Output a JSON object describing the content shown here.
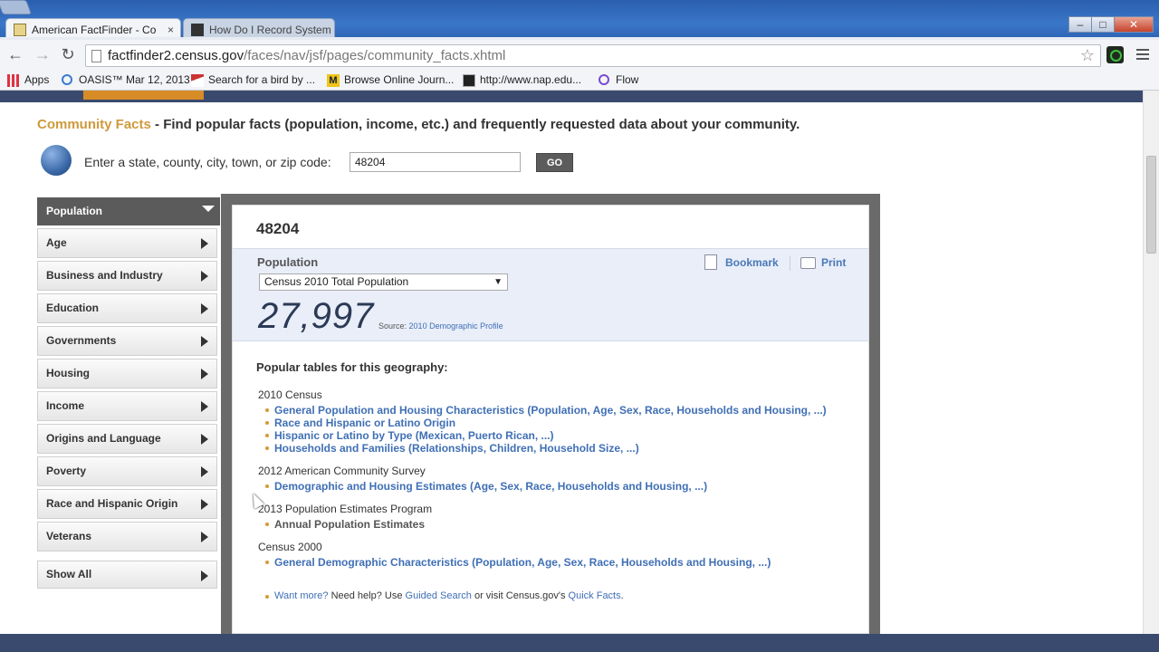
{
  "browser": {
    "tabs": [
      {
        "label": "American FactFinder - Co",
        "active": true
      },
      {
        "label": "How Do I Record System",
        "active": false
      }
    ],
    "tab_close": "×",
    "url_host": "factfinder2.census.gov",
    "url_path": "/faces/nav/jsf/pages/community_facts.xhtml",
    "window_buttons": {
      "minimize": "–",
      "maximize": "□",
      "close": "✕"
    },
    "nav": {
      "back": "←",
      "forward": "→",
      "reload": "↻"
    },
    "star": "☆",
    "bookmarks": [
      "Apps",
      "OASIS™ Mar 12, 2013",
      "Search for a bird by ...",
      "Browse Online Journ...",
      "http://www.nap.edu...",
      "Flow"
    ]
  },
  "page": {
    "heading_accent": "Community Facts",
    "heading_rest": " - Find popular facts (population, income, etc.) and frequently requested data about your community.",
    "search_label": "Enter a state, county, city, town, or zip code:",
    "search_value": "48204",
    "go_label": "GO"
  },
  "sidebar": {
    "header": "Population",
    "items": [
      "Age",
      "Business and Industry",
      "Education",
      "Governments",
      "Housing",
      "Income",
      "Origins and Language",
      "Poverty",
      "Race and Hispanic Origin",
      "Veterans"
    ],
    "show_all": "Show All"
  },
  "panel": {
    "geo_title": "48204",
    "fact_label": "Population",
    "fact_select": "Census 2010 Total Population",
    "fact_value": "27,997",
    "source_label": "Source:",
    "source_link": "2010 Demographic Profile",
    "bookmark_label": "Bookmark",
    "print_label": "Print",
    "popular_heading": "Popular tables for this geography:",
    "groups": [
      {
        "title": "2010 Census",
        "links": [
          "General Population and Housing Characteristics (Population, Age, Sex, Race, Households and Housing, ...)",
          "Race and Hispanic or Latino Origin",
          "Hispanic or Latino by Type (Mexican, Puerto Rican, ...)",
          "Households and Families (Relationships, Children, Household Size, ...)"
        ]
      },
      {
        "title": "2012 American Community Survey",
        "links": [
          "Demographic and Housing Estimates (Age, Sex, Race, Households and Housing, ...)"
        ]
      },
      {
        "title": "2013 Population Estimates Program",
        "plain": [
          "Annual Population Estimates"
        ]
      },
      {
        "title": "Census 2000",
        "links": [
          "General Demographic Characteristics (Population, Age, Sex, Race, Households and Housing, ...)"
        ]
      }
    ],
    "footer": {
      "want_more": "Want more?",
      "need_help": " Need help? Use ",
      "guided_search": "Guided Search",
      "or_visit": " or visit Census.gov's ",
      "quick_facts": "Quick Facts",
      "period": "."
    }
  },
  "colors": {
    "accent": "#cf9a3c",
    "link": "#3f6fb5",
    "header_bar": "#3a4a6e"
  }
}
